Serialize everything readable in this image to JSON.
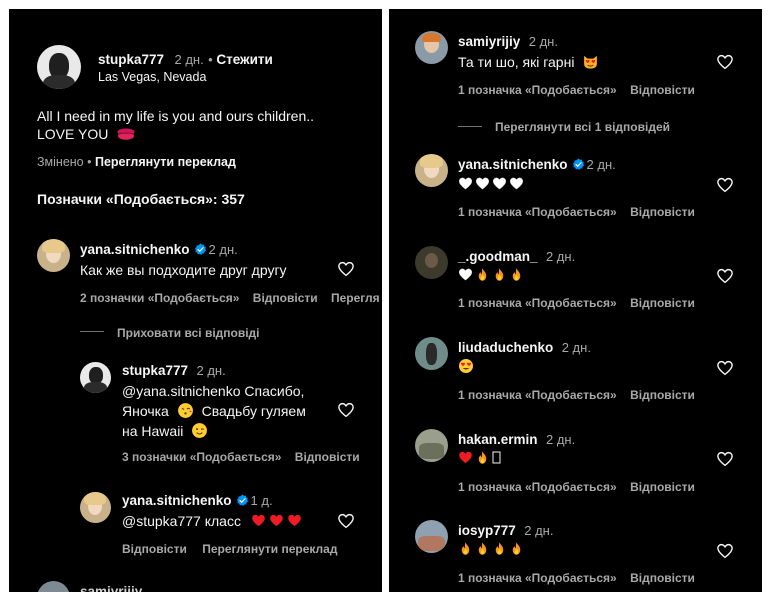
{
  "post": {
    "author": "stupka777",
    "age": "2 дн.",
    "follow": "Стежити",
    "location": "Las Vegas, Nevada",
    "caption_line1": "All I need in my life is you and ours children..",
    "caption_line2": "LOVE YOU",
    "edited": "Змінено",
    "translate": "Переглянути переклад",
    "likes": "Позначки «Подобається»: 357"
  },
  "left": {
    "c1": {
      "user": "yana.sitnichenko",
      "age": "2 дн.",
      "text": "Как же вы подходите друг другу",
      "likes": "2 позначки «Подобається»",
      "reply": "Відповісти",
      "extra": "Перегля"
    },
    "hide_replies": "Приховати всі відповіді",
    "r1": {
      "user": "stupka777",
      "age": "2 дн.",
      "line1": "@yana.sitnichenko Спасибо,",
      "line2": "Яночка",
      "line2b": "Свадьбу гуляем",
      "line3": "на Hawaii",
      "likes": "3 позначки «Подобається»",
      "reply": "Відповісти"
    },
    "r2": {
      "user": "yana.sitnichenko",
      "age": "1 д.",
      "text": "@stupka777 класс",
      "reply": "Відповісти",
      "translate": "Переглянути переклад"
    },
    "cut_user": "samiyrijiy"
  },
  "right": {
    "c1": {
      "user": "samiyrijiy",
      "age": "2 дн.",
      "text": "Та ти шо, які гарні",
      "likes": "1 позначка «Подобається»",
      "reply": "Відповісти"
    },
    "view_replies": "Переглянути всі 1 відповідей",
    "c2": {
      "user": "yana.sitnichenko",
      "age": "2 дн.",
      "likes": "1 позначка «Подобається»",
      "reply": "Відповісти"
    },
    "c3": {
      "user": "_.goodman_",
      "age": "2 дн.",
      "likes": "1 позначка «Подобається»",
      "reply": "Відповісти"
    },
    "c4": {
      "user": "liudaduchenko",
      "age": "2 дн.",
      "likes": "1 позначка «Подобається»",
      "reply": "Відповісти"
    },
    "c5": {
      "user": "hakan.ermin",
      "age": "2 дн.",
      "likes": "1 позначка «Подобається»",
      "reply": "Відповісти"
    },
    "c6": {
      "user": "iosyp777",
      "age": "2 дн.",
      "likes": "1 позначка «Подобається»",
      "reply": "Відповісти"
    }
  },
  "colors": {
    "bg": "#000000",
    "text": "#f5f5f5",
    "muted": "#a8a8a8",
    "verified": "#0095f6",
    "heart_red": "#ed1c24"
  },
  "icons": [
    "heart-outline-icon",
    "verified-badge-icon",
    "red-heart-emoji",
    "white-heart-emoji",
    "fire-emoji",
    "kiss-emoji",
    "wink-emoji",
    "heart-eyes-emoji",
    "smiling-heart-eyes-cat-emoji",
    "lips-emoji",
    "missing-glyph-box"
  ]
}
